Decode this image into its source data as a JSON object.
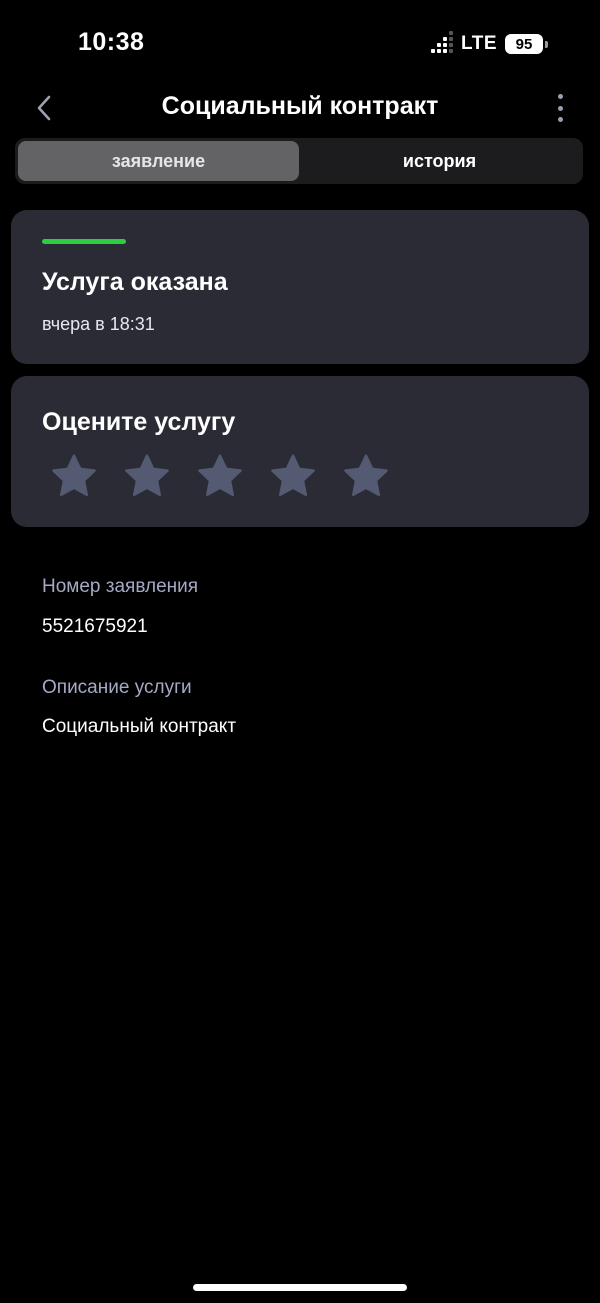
{
  "status_bar": {
    "time": "10:38",
    "network": "LTE",
    "battery": "95"
  },
  "header": {
    "title": "Социальный контракт",
    "back_icon": "chevron-left-icon",
    "more_icon": "more-vertical-icon"
  },
  "tabs": [
    {
      "label": "заявление",
      "active": true
    },
    {
      "label": "история",
      "active": false
    }
  ],
  "status_card": {
    "title": "Услуга оказана",
    "time": "вчера в 18:31",
    "accent_color": "#2ecc40"
  },
  "rating_card": {
    "title": "Оцените услугу",
    "max_stars": 5,
    "rating": 0,
    "star_color": "#545a72"
  },
  "info": {
    "number_label": "Номер заявления",
    "number_value": "5521675921",
    "description_label": "Описание услуги",
    "description_value": "Социальный контракт"
  },
  "colors": {
    "background": "#000000",
    "card": "#2a2b35",
    "label": "#a5a9c4"
  }
}
